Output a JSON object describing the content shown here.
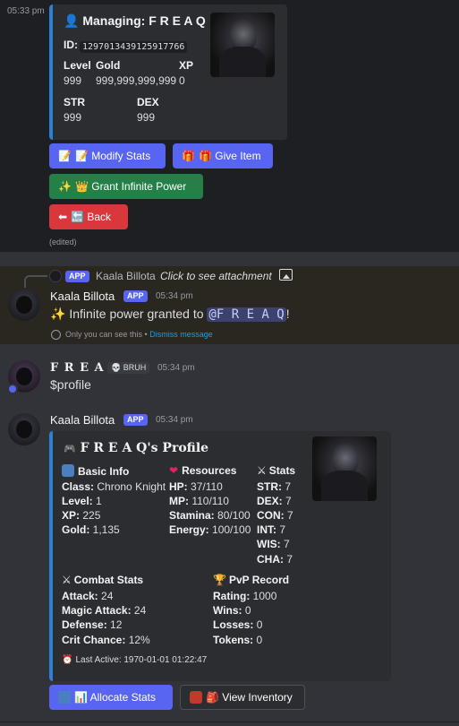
{
  "top_message": {
    "timestamp": "05:33 pm",
    "embed": {
      "title_icon": "bust-icon",
      "title": "Managing: F R E A Q",
      "id_label": "ID:",
      "id_value": "1297013439125917766",
      "level_label": "Level",
      "level_value": "999",
      "gold_label": "Gold",
      "gold_value": "999,999,999,999",
      "xp_label": "XP",
      "xp_value": "0",
      "str_label": "STR",
      "str_value": "999",
      "dex_label": "DEX",
      "dex_value": "999"
    },
    "buttons": {
      "modify_stats": "📝 Modify Stats",
      "give_item": "🎁 Give Item",
      "grant_power": "👑 Grant Infinite Power",
      "back": "🔙 Back"
    },
    "button_emojis": {
      "modify_stats": "📝",
      "give_item": "🎁",
      "grant_power": "✨",
      "back": "⬅"
    },
    "edited": "(edited)"
  },
  "ephemeral_message": {
    "reply_tag": "APP",
    "reply_author": "Kaala Billota",
    "reply_text": "Click to see attachment",
    "author": "Kaala Billota",
    "tag": "APP",
    "timestamp": "05:34 pm",
    "text_prefix": "✨ Infinite power granted to ",
    "mention": "@F R E A Q",
    "text_suffix": "!",
    "only_you": "Only you can see this •",
    "dismiss": "Dismiss message"
  },
  "freaq_message": {
    "author": "F R E A Q",
    "badge": "💀 BRUH",
    "timestamp": "05:34 pm",
    "text": "$profile"
  },
  "profile_message": {
    "author": "Kaala Billota",
    "tag": "APP",
    "timestamp": "05:34 pm",
    "embed": {
      "title": "F R E A Q's Profile",
      "basic_info": {
        "heading": "Basic Info",
        "class_label": "Class:",
        "class_value": "Chrono Knight",
        "level_label": "Level:",
        "level_value": "1",
        "xp_label": "XP:",
        "xp_value": "225",
        "gold_label": "Gold:",
        "gold_value": "1,135"
      },
      "resources": {
        "heading": "Resources",
        "hp_label": "HP:",
        "hp_value": "37/110",
        "mp_label": "MP:",
        "mp_value": "110/110",
        "stamina_label": "Stamina:",
        "stamina_value": "80/100",
        "energy_label": "Energy:",
        "energy_value": "100/100"
      },
      "stats": {
        "heading": "Stats",
        "str_label": "STR:",
        "str_value": "7",
        "dex_label": "DEX:",
        "dex_value": "7",
        "con_label": "CON:",
        "con_value": "7",
        "int_label": "INT:",
        "int_value": "7",
        "wis_label": "WIS:",
        "wis_value": "7",
        "cha_label": "CHA:",
        "cha_value": "7"
      },
      "combat": {
        "heading": "Combat Stats",
        "attack_label": "Attack:",
        "attack_value": "24",
        "magic_label": "Magic Attack:",
        "magic_value": "24",
        "defense_label": "Defense:",
        "defense_value": "12",
        "crit_label": "Crit Chance:",
        "crit_value": "12%"
      },
      "pvp": {
        "heading": "PvP Record",
        "rating_label": "Rating:",
        "rating_value": "1000",
        "wins_label": "Wins:",
        "wins_value": "0",
        "losses_label": "Losses:",
        "losses_value": "0",
        "tokens_label": "Tokens:",
        "tokens_value": "0"
      },
      "last_active": "Last Active: 1970-01-01 01:22:47"
    },
    "buttons": {
      "allocate": "📊 Allocate Stats",
      "inventory": "🎒 View Inventory"
    }
  },
  "colors": {
    "accent_embed": "#2b82d4",
    "blurple": "#5865f2",
    "green": "#248046",
    "red": "#da373c"
  }
}
